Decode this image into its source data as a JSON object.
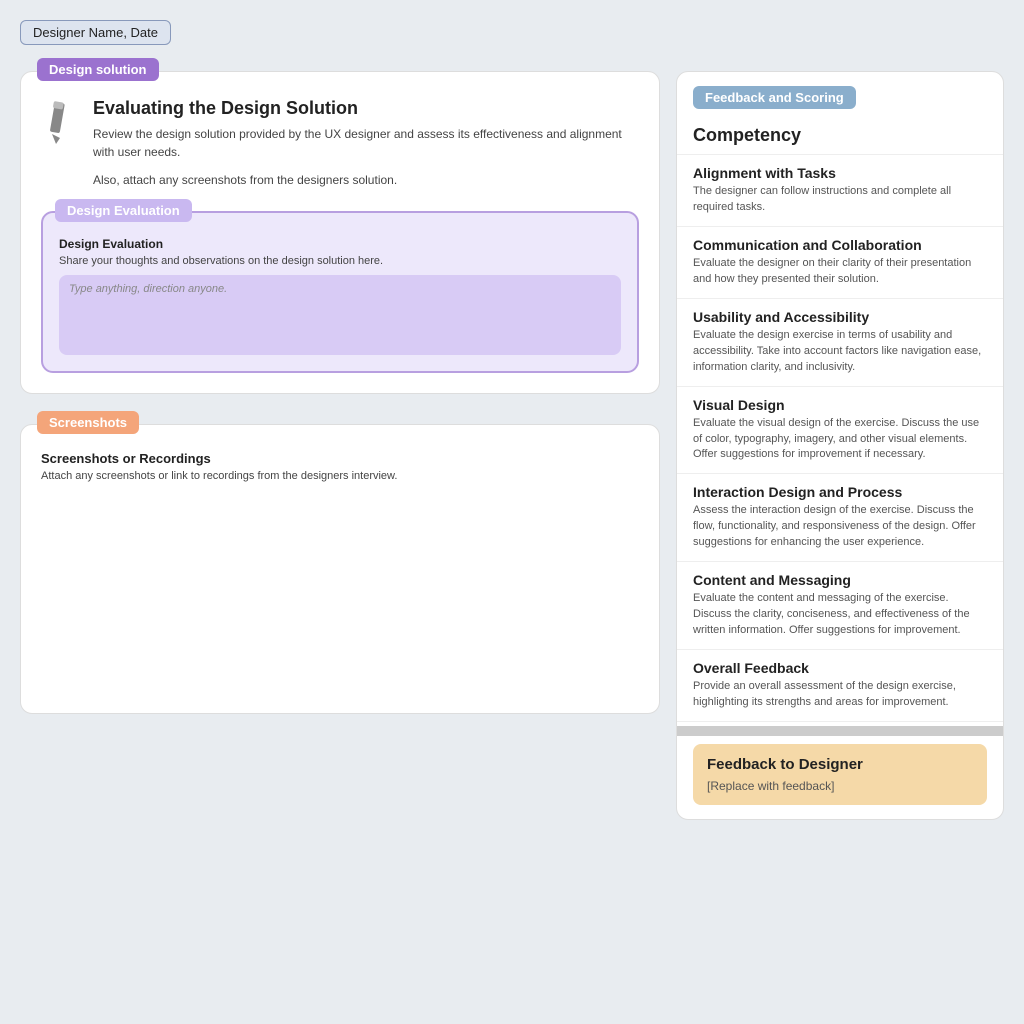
{
  "designer_badge": "Designer Name, Date",
  "left_col": {
    "design_solution": {
      "badge": "Design solution",
      "title": "Evaluating the Design Solution",
      "desc1": "Review the design solution provided by the UX designer and assess its effectiveness and alignment with user needs.",
      "desc2": "Also, attach any screenshots from the designers solution.",
      "design_evaluation": {
        "badge": "Design Evaluation",
        "inner_label": "Design Evaluation",
        "inner_desc": "Share your thoughts and observations on the design solution here.",
        "textarea_placeholder": "Type anything, direction anyone."
      }
    },
    "screenshots": {
      "badge": "Screenshots",
      "inner_title": "Screenshots or Recordings",
      "inner_desc": "Attach any screenshots or link to recordings from the designers interview."
    }
  },
  "right_col": {
    "feedback_badge": "Feedback and Scoring",
    "competency_header": "Competency",
    "items": [
      {
        "title": "Alignment with Tasks",
        "desc": "The designer can follow instructions and complete all required tasks."
      },
      {
        "title": "Communication and Collaboration",
        "desc": "Evaluate the designer on their clarity of their presentation and how they presented their solution."
      },
      {
        "title": "Usability and Accessibility",
        "desc": "Evaluate the design exercise in terms of usability and accessibility. Take into account factors like navigation ease, information clarity, and inclusivity."
      },
      {
        "title": "Visual Design",
        "desc": "Evaluate the visual design of the exercise. Discuss the use of color, typography, imagery, and other visual elements. Offer suggestions for improvement if necessary."
      },
      {
        "title": "Interaction Design and Process",
        "desc": "Assess the interaction design of the exercise. Discuss the flow, functionality, and responsiveness of the design. Offer suggestions for enhancing the user experience."
      },
      {
        "title": "Content and Messaging",
        "desc": "Evaluate the content and messaging of the exercise. Discuss the clarity, conciseness, and effectiveness of the written information. Offer suggestions for improvement."
      },
      {
        "title": "Overall Feedback",
        "desc": "Provide an overall assessment of the design exercise, highlighting its strengths and areas for improvement."
      }
    ],
    "feedback_to_designer": {
      "title": "Feedback to Designer",
      "placeholder": "[Replace with feedback]"
    }
  }
}
